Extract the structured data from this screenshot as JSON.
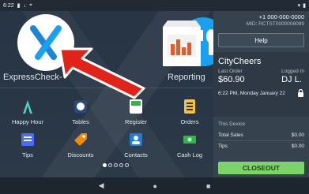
{
  "status_bar": {
    "time": "6:22",
    "left_icons": [
      "sim-icon",
      "download-icon",
      "location-icon"
    ],
    "right_icons": [
      "wifi-icon",
      "battery-icon"
    ]
  },
  "account": {
    "phone": "+1 000-000-0000",
    "mid": "MID: RCTST0000008099",
    "help_label": "Help"
  },
  "big_apps": [
    {
      "label": "ExpressCheck-",
      "icon": "expresscheck-icon",
      "accent": "#1aa0f0"
    },
    {
      "label": "",
      "icon": "dining-icon",
      "accent": "#1aa0f0"
    },
    {
      "label": "Reporting",
      "icon": "reporting-icon",
      "accent": "#e85a2a"
    }
  ],
  "apps": [
    {
      "label": "Happy Hour",
      "icon": "happy-hour-icon"
    },
    {
      "label": "Tables",
      "icon": "tables-icon"
    },
    {
      "label": "Register",
      "icon": "register-icon"
    },
    {
      "label": "Orders",
      "icon": "orders-icon"
    },
    {
      "label": "Tips",
      "icon": "tips-icon"
    },
    {
      "label": "Discounts",
      "icon": "discounts-icon"
    },
    {
      "label": "Contacts",
      "icon": "contacts-icon"
    },
    {
      "label": "Cash Log",
      "icon": "cash-log-icon"
    }
  ],
  "pagination": {
    "pages": 5,
    "active": 1
  },
  "merchant": {
    "name": "CityCheers",
    "last_order_caption": "Last Order",
    "last_order_value": "$60.90",
    "logged_in_caption": "Logged In",
    "logged_in_value": "DJ L.",
    "datetime": "6:22 PM, Monday January 22"
  },
  "device": {
    "header": "This Device",
    "total_sales_label": "Total Sales",
    "total_sales_value": "$0.00",
    "tips_label": "Tips",
    "tips_value": "$0.00"
  },
  "closeout_label": "CLOSEOUT",
  "nav": {
    "back": "◀",
    "home": "●",
    "recent": "■"
  },
  "colors": {
    "closeout_bg": "#7bd36a",
    "annotation_arrow": "#e2231a",
    "express_blue": "#1aa0f0"
  }
}
